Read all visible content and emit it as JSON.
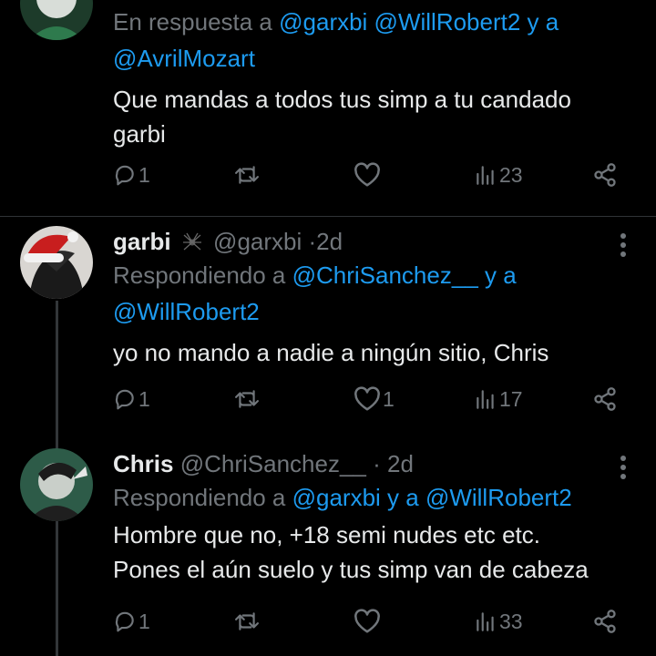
{
  "tweets": [
    {
      "reply_prefix": "En respuesta a ",
      "reply_mentions_1": "@garxbi @WillRobert2 y a",
      "reply_mentions_2": "@AvrilMozart",
      "text_1": "Que mandas a todos tus simp a tu candado",
      "text_2": "garbi",
      "replies": "1",
      "retweets": "",
      "likes": "",
      "views": "23"
    },
    {
      "name": "garbi",
      "handle": "@garxbi",
      "separator": "·",
      "time": "2d",
      "reply_prefix": "Respondiendo a ",
      "reply_mentions_1": "@ChriSanchez__ y a",
      "reply_mentions_2": "@WillRobert2",
      "text_1": "yo no mando a nadie a ningún sitio, Chris",
      "replies": "1",
      "retweets": "",
      "likes": "1",
      "views": "17"
    },
    {
      "name": "Chris",
      "handle": "@ChriSanchez__",
      "separator": "·",
      "time": "2d",
      "reply_prefix": "Respondiendo a ",
      "reply_mentions_1": "@garxbi y a @WillRobert2",
      "text_1": "Hombre que no, +18 semi nudes  etc etc.",
      "text_2": "Pones el aún suelo y tus simp van de cabeza",
      "replies": "1",
      "retweets": "",
      "likes": "",
      "views": "33"
    }
  ],
  "colors": {
    "background": "#000000",
    "text": "#e7e9ea",
    "muted": "#71767b",
    "accent": "#1d9bf0"
  },
  "icons": [
    "reply-icon",
    "retweet-icon",
    "like-icon",
    "views-icon",
    "share-icon",
    "more-icon",
    "spider-emoji-icon"
  ]
}
